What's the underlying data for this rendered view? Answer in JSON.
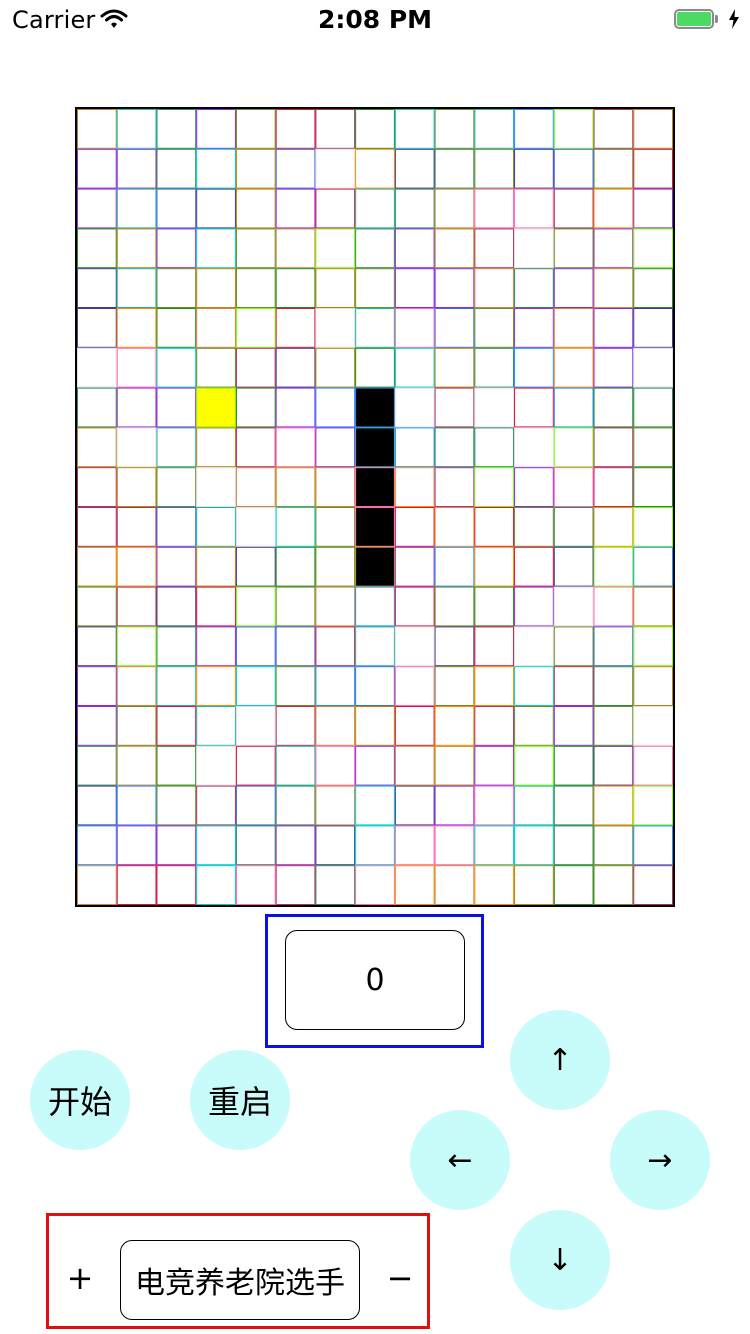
{
  "status_bar": {
    "carrier": "Carrier",
    "time": "2:08 PM",
    "battery_color": "#4cd964"
  },
  "game": {
    "grid_cols": 15,
    "grid_rows": 20,
    "snake_color": "#000000",
    "food_color": "#ffff00",
    "snake_cells": [
      [
        7,
        7
      ],
      [
        7,
        8
      ],
      [
        7,
        9
      ],
      [
        7,
        10
      ],
      [
        7,
        11
      ]
    ],
    "food_cell": [
      3,
      7
    ]
  },
  "score": {
    "value": "0",
    "frame_color": "#0a10e6"
  },
  "controls": {
    "start_label": "开始",
    "restart_label": "重启",
    "up_label": "↑",
    "left_label": "←",
    "right_label": "→",
    "down_label": "↓",
    "button_color": "#c7fcfb"
  },
  "difficulty": {
    "plus_label": "+",
    "minus_label": "−",
    "level_label": "电竞养老院选手",
    "frame_color": "#e01010"
  }
}
